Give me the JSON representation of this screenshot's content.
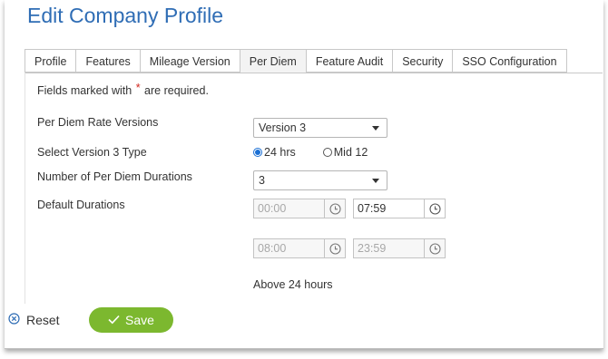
{
  "page": {
    "title": "Edit Company Profile"
  },
  "tabs": [
    {
      "label": "Profile",
      "active": false
    },
    {
      "label": "Features",
      "active": false
    },
    {
      "label": "Mileage Version",
      "active": false
    },
    {
      "label": "Per Diem",
      "active": true
    },
    {
      "label": "Feature Audit",
      "active": false
    },
    {
      "label": "Security",
      "active": false
    },
    {
      "label": "SSO Configuration",
      "active": false
    }
  ],
  "form": {
    "required_note_prefix": "Fields marked with",
    "required_star": "*",
    "required_note_suffix": "are required.",
    "rate_versions_label": "Per Diem Rate Versions",
    "rate_versions_value": "Version 3",
    "version_type_label": "Select Version 3 Type",
    "version_type_options": [
      {
        "label": "24 hrs",
        "selected": true
      },
      {
        "label": "Mid 12",
        "selected": false
      }
    ],
    "durations_count_label": "Number of Per Diem Durations",
    "durations_count_value": "3",
    "default_durations_label": "Default Durations",
    "durations": [
      {
        "start": "00:00",
        "end": "07:59",
        "start_disabled": true,
        "end_disabled": false
      },
      {
        "start": "08:00",
        "end": "23:59",
        "start_disabled": true,
        "end_disabled": true
      }
    ],
    "above_24_label": "Above 24 hours"
  },
  "actions": {
    "reset_label": "Reset",
    "save_label": "Save"
  },
  "icons": {
    "clock": "clock-icon",
    "reset": "close-circle-icon",
    "save": "checkmark-icon",
    "caret": "chevron-down-icon"
  },
  "colors": {
    "title": "#2f6db5",
    "save_button": "#7cb82f",
    "required_star": "#d0241c",
    "radio_accent": "#1a6fd4",
    "reset_icon": "#2f6db5"
  }
}
